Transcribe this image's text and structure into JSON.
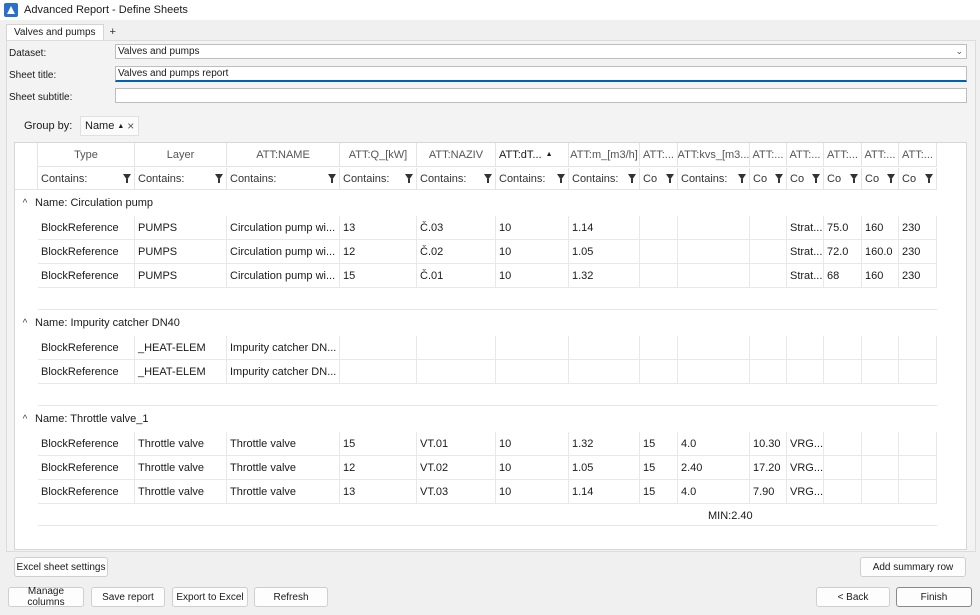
{
  "window": {
    "title": "Advanced Report - Define Sheets"
  },
  "tabs": {
    "active": "Valves and pumps",
    "add": "+"
  },
  "form": {
    "dataset_label": "Dataset:",
    "dataset_value": "Valves and pumps",
    "sheet_title_label": "Sheet title:",
    "sheet_title_value": "Valves and pumps report",
    "sheet_subtitle_label": "Sheet subtitle:",
    "sheet_subtitle_value": ""
  },
  "group_by": {
    "label": "Group by:",
    "chip": "Name",
    "sort": "▲",
    "remove": "×"
  },
  "columns": [
    {
      "label": "Type",
      "filter": "Contains:"
    },
    {
      "label": "Layer",
      "filter": "Contains:"
    },
    {
      "label": "ATT:NAME",
      "filter": "Contains:"
    },
    {
      "label": "ATT:Q_[kW]",
      "filter": "Contains:"
    },
    {
      "label": "ATT:NAZIV",
      "filter": "Contains:"
    },
    {
      "label": "ATT:dT...",
      "filter": "Contains:",
      "sorted": "▲"
    },
    {
      "label": "ATT:m_[m3/h]",
      "filter": "Contains:"
    },
    {
      "label": "ATT:...",
      "filter": "Co"
    },
    {
      "label": "ATT:kvs_[m3...",
      "filter": "Contains:"
    },
    {
      "label": "ATT:...",
      "filter": "Co"
    },
    {
      "label": "ATT:...",
      "filter": "Co"
    },
    {
      "label": "ATT:...",
      "filter": "Co"
    },
    {
      "label": "ATT:...",
      "filter": "Co"
    },
    {
      "label": "ATT:...",
      "filter": "Co"
    }
  ],
  "groups": [
    {
      "label": "Name: Circulation pump",
      "toggle": "^",
      "rows": [
        [
          "BlockReference",
          "PUMPS",
          "Circulation pump wi...",
          "13",
          "Č.03",
          "10",
          "1.14",
          "",
          "",
          "",
          "Strat...",
          "75.0",
          "160",
          "230"
        ],
        [
          "BlockReference",
          "PUMPS",
          "Circulation pump wi...",
          "12",
          "Č.02",
          "10",
          "1.05",
          "",
          "",
          "",
          "Strat...",
          "72.0",
          "160.0",
          "230"
        ],
        [
          "BlockReference",
          "PUMPS",
          "Circulation pump wi...",
          "15",
          "Č.01",
          "10",
          "1.32",
          "",
          "",
          "",
          "Strat...",
          "68",
          "160",
          "230"
        ]
      ]
    },
    {
      "label": "Name: Impurity catcher DN40",
      "toggle": "^",
      "rows": [
        [
          "BlockReference",
          "_HEAT-ELEM",
          "Impurity catcher DN...",
          "",
          "",
          "",
          "",
          "",
          "",
          "",
          "",
          "",
          "",
          ""
        ],
        [
          "BlockReference",
          "_HEAT-ELEM",
          "Impurity catcher DN...",
          "",
          "",
          "",
          "",
          "",
          "",
          "",
          "",
          "",
          "",
          ""
        ]
      ]
    },
    {
      "label": "Name: Throttle valve_1",
      "toggle": "^",
      "rows": [
        [
          "BlockReference",
          "Throttle valve",
          "Throttle valve",
          "15",
          "VT.01",
          "10",
          "1.32",
          "15",
          "4.0",
          "10.30",
          "VRG...",
          "",
          "",
          ""
        ],
        [
          "BlockReference",
          "Throttle valve",
          "Throttle valve",
          "12",
          "VT.02",
          "10",
          "1.05",
          "15",
          "2.40",
          "17.20",
          "VRG...",
          "",
          "",
          ""
        ],
        [
          "BlockReference",
          "Throttle valve",
          "Throttle valve",
          "13",
          "VT.03",
          "10",
          "1.14",
          "15",
          "4.0",
          "7.90",
          "VRG...",
          "",
          "",
          ""
        ]
      ],
      "summary": "MIN:2.40"
    }
  ],
  "buttons": {
    "excel_sheet_settings": "Excel sheet settings",
    "add_summary_row": "Add summary row",
    "manage_columns": "Manage columns",
    "save_report": "Save report",
    "export_to_excel": "Export to Excel",
    "refresh": "Refresh",
    "back": "< Back",
    "finish": "Finish"
  }
}
